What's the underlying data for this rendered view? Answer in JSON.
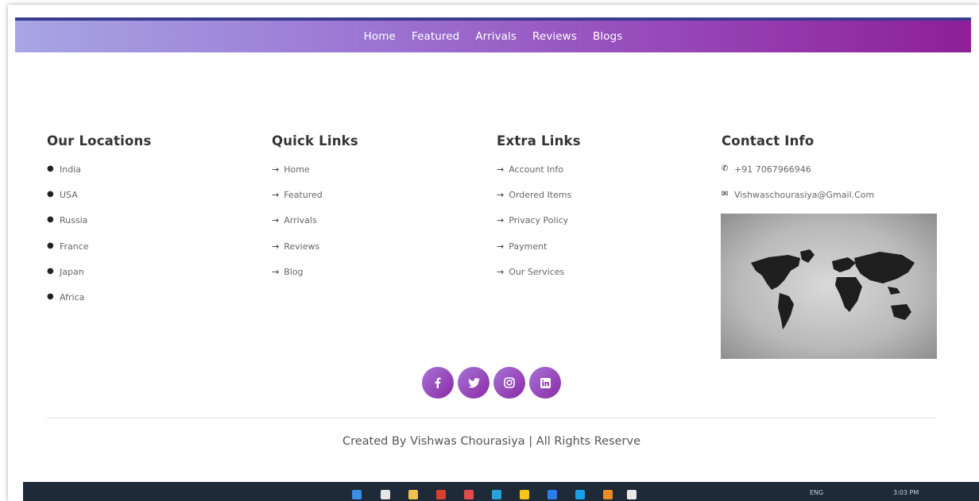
{
  "nav": {
    "items": [
      "Home",
      "Featured",
      "Arrivals",
      "Reviews",
      "Blogs"
    ]
  },
  "footer": {
    "locations": {
      "title": "Our Locations",
      "items": [
        "India",
        "USA",
        "Russia",
        "France",
        "Japan",
        "Africa"
      ]
    },
    "quick_links": {
      "title": "Quick Links",
      "items": [
        "Home",
        "Featured",
        "Arrivals",
        "Reviews",
        "Blog"
      ]
    },
    "extra_links": {
      "title": "Extra Links",
      "items": [
        "Account Info",
        "Ordered Items",
        "Privacy Policy",
        "Payment",
        "Our Services"
      ]
    },
    "contact": {
      "title": "Contact Info",
      "phone": "+91 7067966946",
      "email": "Vishwaschourasiya@Gmail.Com"
    },
    "socials": [
      "facebook-icon",
      "twitter-icon",
      "instagram-icon",
      "linkedin-icon"
    ],
    "credit": "Created By Vishwas Chourasiya | All Rights Reserve"
  },
  "taskbar": {
    "lang": "ENG",
    "time": "3:03 PM"
  },
  "colors": {
    "nav_start": "#a7a6e4",
    "nav_end": "#8e1f98",
    "social_bg": "#9a4fc0"
  }
}
